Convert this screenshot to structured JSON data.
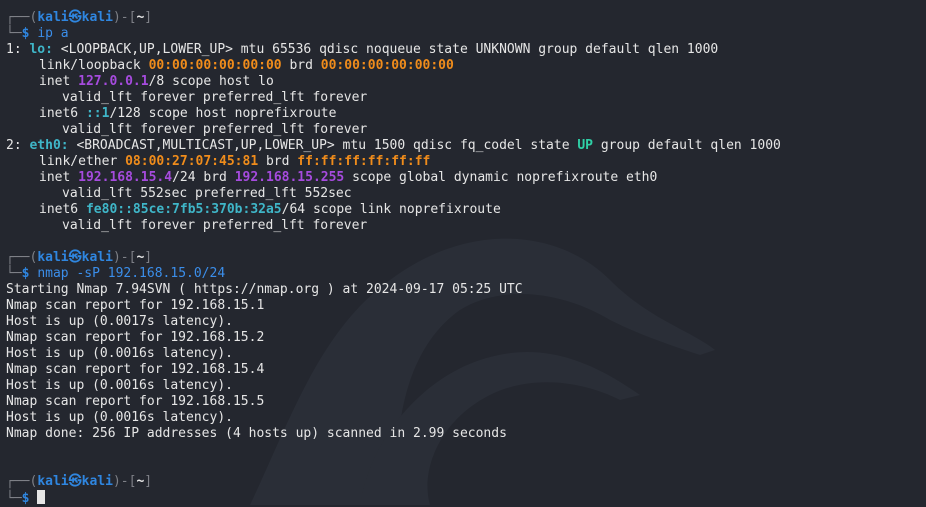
{
  "prompt": {
    "top_open": "┌──(",
    "user": "kali",
    "at": "㉿",
    "host": "kali",
    "mid": ")-[",
    "dir": "~",
    "close": "]",
    "bottom": "└─",
    "dollar": "$"
  },
  "cmd1": "ip a",
  "ip": {
    "lo_head": {
      "n": "1: ",
      "name": "lo:",
      "rest": " <LOOPBACK,UP,LOWER_UP> mtu 65536 qdisc noqueue state UNKNOWN group default qlen 1000"
    },
    "lo_link": {
      "a": "link/loopback ",
      "mac": "00:00:00:00:00:00",
      "b": " brd ",
      "brd": "00:00:00:00:00:00"
    },
    "lo_inet": {
      "a": "inet ",
      "ip": "127.0.0.1",
      "b": "/8 scope host lo"
    },
    "lo_valid1": "valid_lft forever preferred_lft forever",
    "lo_inet6": {
      "a": "inet6 ",
      "ip": "::1",
      "b": "/128 scope host noprefixroute"
    },
    "lo_valid2": "valid_lft forever preferred_lft forever",
    "eth_head": {
      "n": "2: ",
      "name": "eth0:",
      "a": " <BROADCAST,MULTICAST,UP,LOWER_UP> mtu 1500 qdisc fq_codel state ",
      "up": "UP",
      "b": " group default qlen 1000"
    },
    "eth_link": {
      "a": "link/ether ",
      "mac": "08:00:27:07:45:81",
      "b": " brd ",
      "brd": "ff:ff:ff:ff:ff:ff"
    },
    "eth_inet": {
      "a": "inet ",
      "ip": "192.168.15.4",
      "b": "/24 brd ",
      "brd": "192.168.15.255",
      "c": " scope global dynamic noprefixroute eth0"
    },
    "eth_valid1": "valid_lft 552sec preferred_lft 552sec",
    "eth_inet6": {
      "a": "inet6 ",
      "ip": "fe80::85ce:7fb5:370b:32a5",
      "b": "/64 scope link noprefixroute"
    },
    "eth_valid2": "valid_lft forever preferred_lft forever"
  },
  "cmd2": "nmap -sP 192.168.15.0/24",
  "nmap_output": [
    "Starting Nmap 7.94SVN ( https://nmap.org ) at 2024-09-17 05:25 UTC",
    "Nmap scan report for 192.168.15.1",
    "Host is up (0.0017s latency).",
    "Nmap scan report for 192.168.15.2",
    "Host is up (0.0016s latency).",
    "Nmap scan report for 192.168.15.4",
    "Host is up (0.0016s latency).",
    "Nmap scan report for 192.168.15.5",
    "Host is up (0.0016s latency).",
    "Nmap done: 256 IP addresses (4 hosts up) scanned in 2.99 seconds"
  ],
  "colors": {
    "background": "#24272f",
    "prompt_user": "#2f86e0",
    "mac": "#f08c1b",
    "ip": "#a64bde",
    "interface": "#3fb6c8",
    "state_up": "#2fd0a6"
  }
}
